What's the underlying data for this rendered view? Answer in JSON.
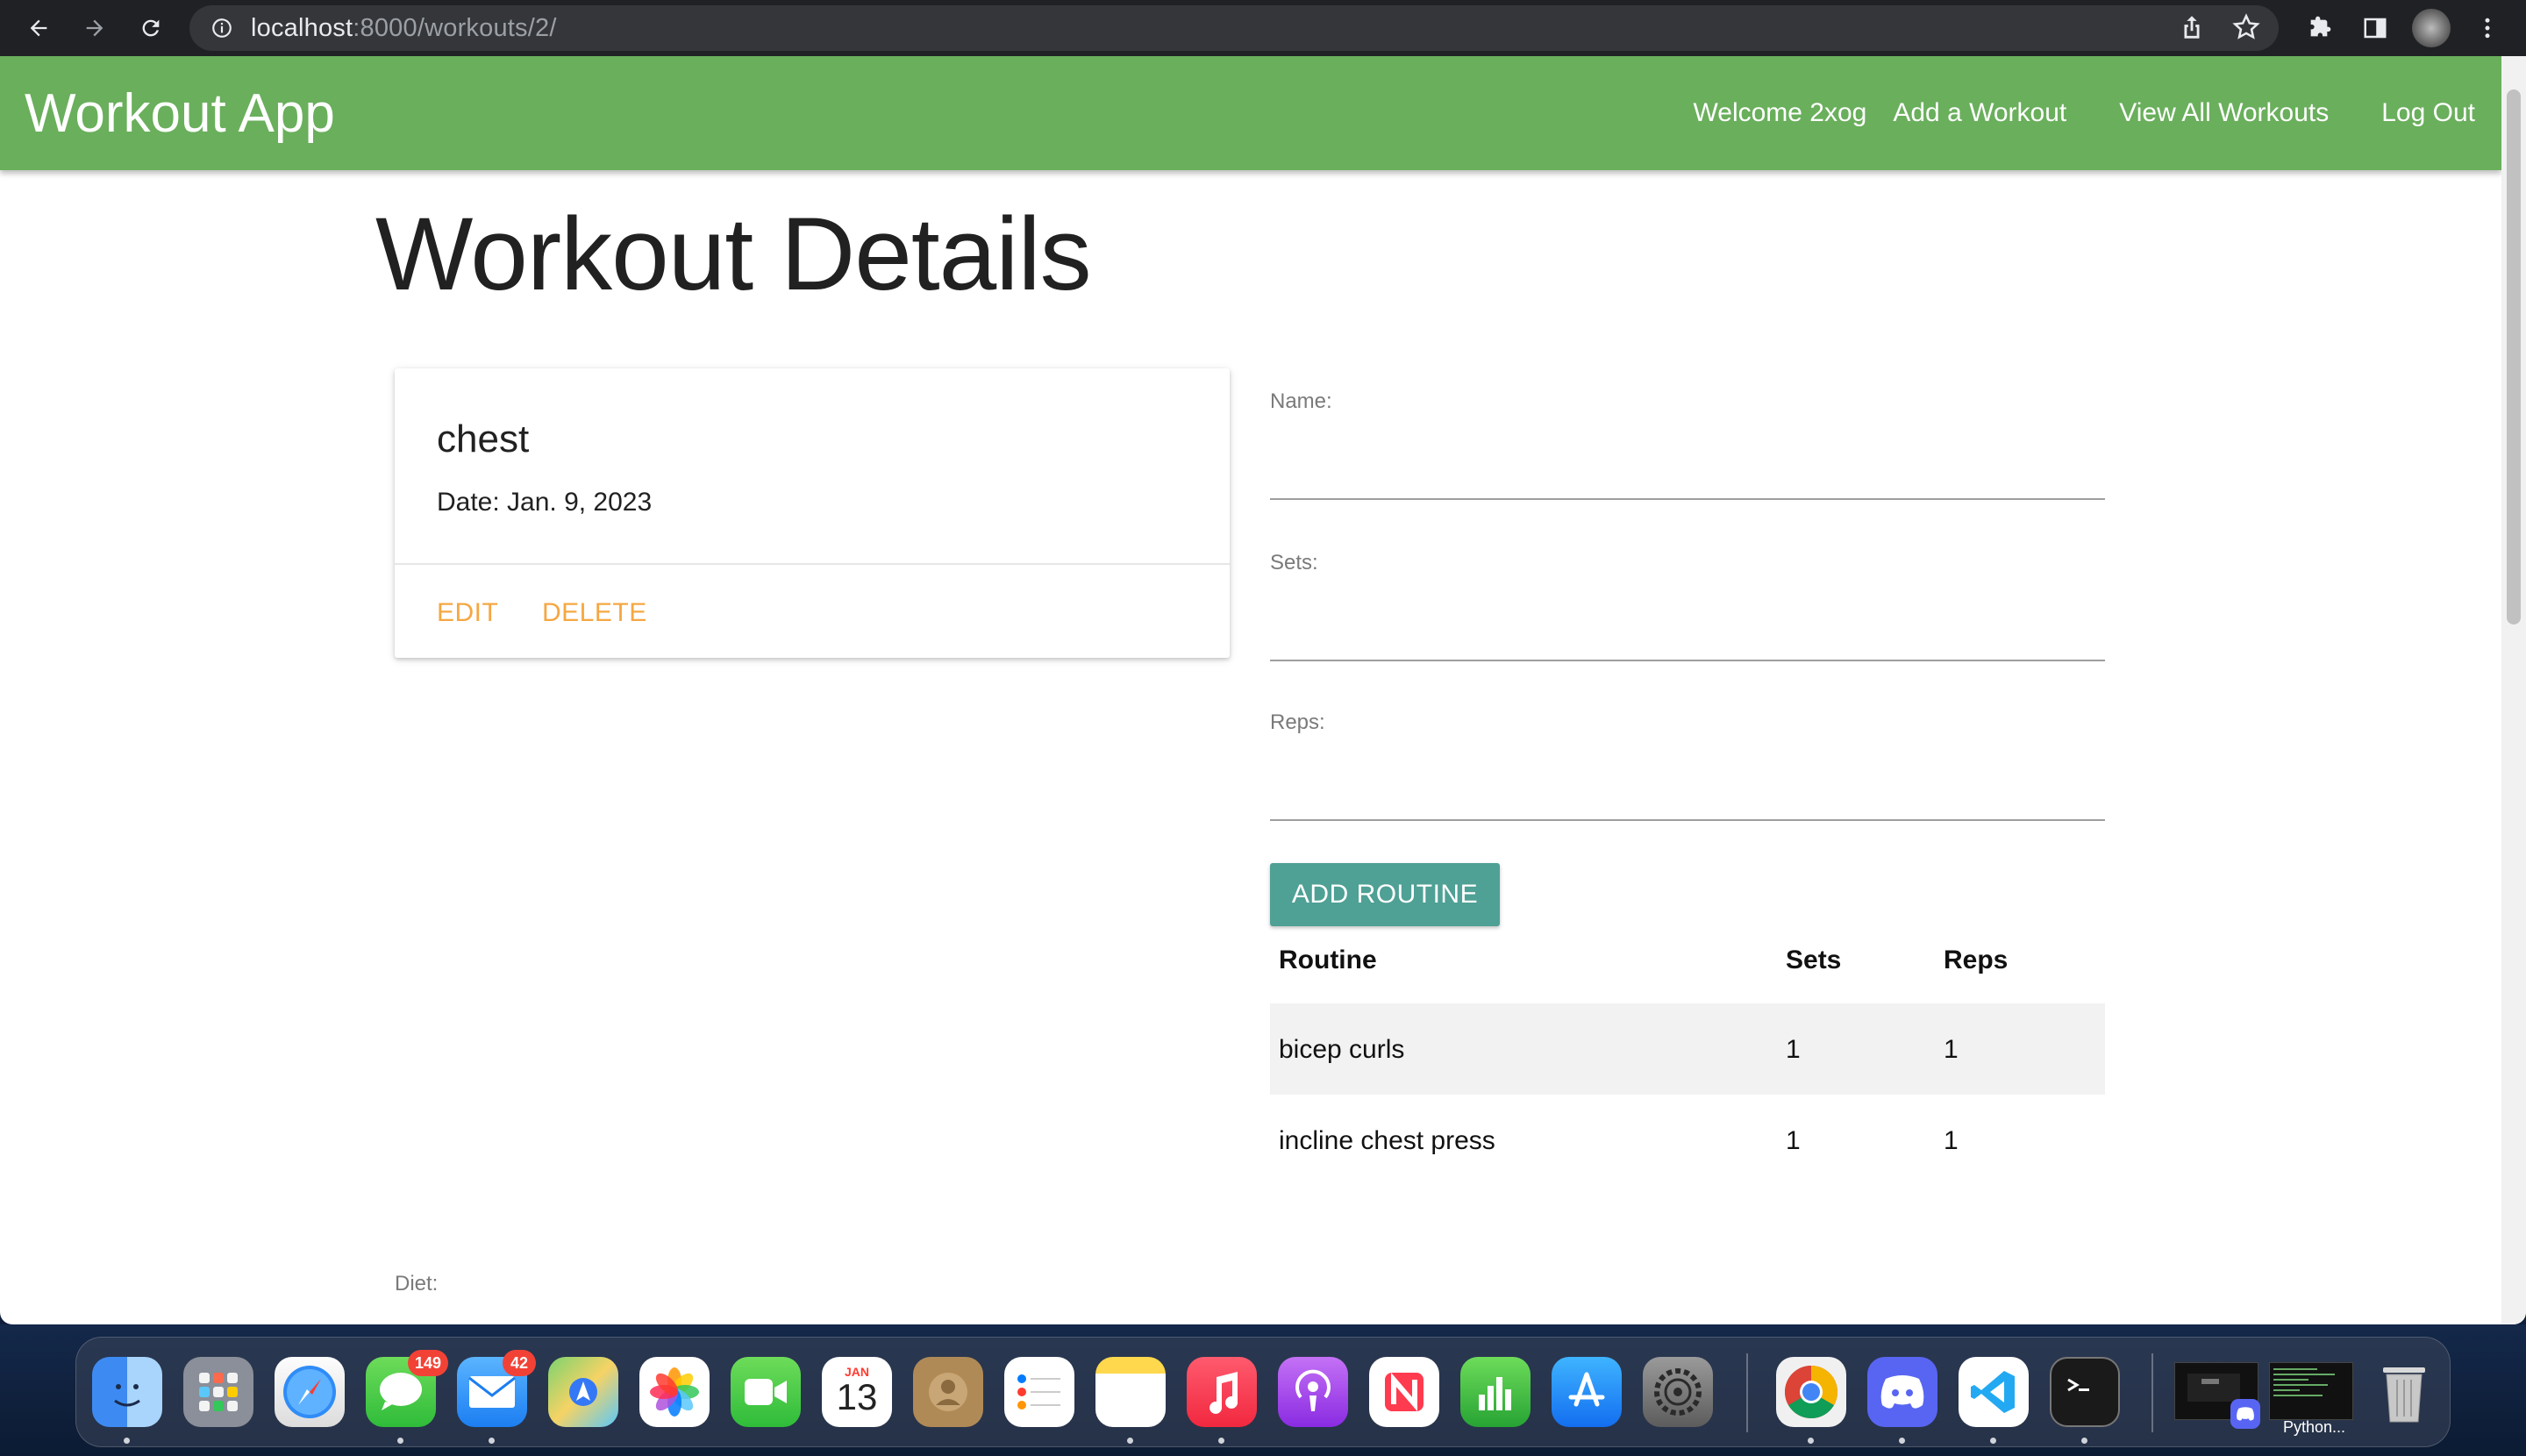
{
  "browser": {
    "url_host": "localhost",
    "url_path": ":8000/workouts/2/"
  },
  "navbar": {
    "brand": "Workout App",
    "welcome": "Welcome 2xog",
    "add_workout": "Add a Workout",
    "view_all": "View All Workouts",
    "logout": "Log Out"
  },
  "page": {
    "title": "Workout Details"
  },
  "workout": {
    "name": "chest",
    "date": "Date: Jan. 9, 2023",
    "edit_label": "Edit",
    "delete_label": "Delete"
  },
  "form": {
    "name_label": "Name:",
    "sets_label": "Sets:",
    "reps_label": "Reps:",
    "submit_label": "Add Routine"
  },
  "routines": {
    "headers": [
      "Routine",
      "Sets",
      "Reps"
    ],
    "rows": [
      {
        "routine": "bicep curls",
        "sets": "1",
        "reps": "1"
      },
      {
        "routine": "incline chest press",
        "sets": "1",
        "reps": "1"
      }
    ]
  },
  "diet": {
    "label": "Diet:"
  },
  "dock": {
    "messages_badge": "149",
    "mail_badge": "42",
    "calendar_month": "JAN",
    "calendar_day": "13",
    "python_label": "Python..."
  },
  "colors": {
    "appbar": "#6aaf5c",
    "accent_link": "#f5a742",
    "button": "#4fa095"
  }
}
